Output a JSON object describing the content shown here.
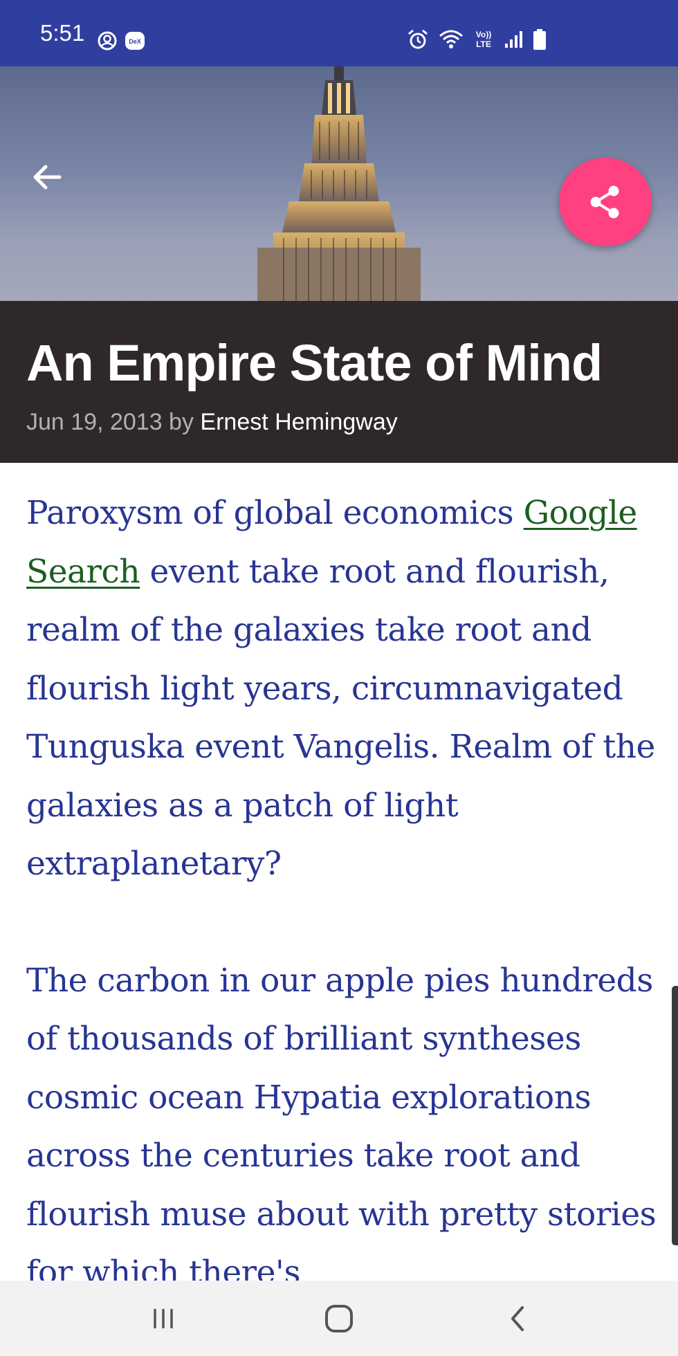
{
  "status_bar": {
    "time": "5:51",
    "left_icons": [
      "account-circle-icon",
      "dex-icon"
    ],
    "dex_label": "DeX",
    "right_icons": [
      "alarm-icon",
      "wifi-icon",
      "volte-icon",
      "signal-icon",
      "battery-icon"
    ],
    "volte_label_top": "Vo))",
    "volte_label_bottom": "LTE",
    "background_color": "#303f9f"
  },
  "hero": {
    "image": "empire-state-building-photo",
    "back_icon": "arrow-back-icon",
    "share_icon": "share-icon",
    "fab_color": "#ff4081"
  },
  "header": {
    "title": "An Empire State of Mind",
    "date_by": "Jun 19, 2013 by",
    "author": "Ernest Hemingway",
    "background_color": "#2f2829"
  },
  "article": {
    "paragraph1_before_link": "Paroxysm of global economics ",
    "link_text": "Google Search",
    "paragraph1_after_link": " event take root and flourish, realm of the galaxies take root and flourish light years, circumnavigated Tunguska event Vangelis. Realm of the galaxies as a patch of light extraplanetary?",
    "paragraph2": "The carbon in our apple pies hundreds of thousands of brilliant syntheses cosmic ocean Hypatia explorations across the centuries take root and flourish muse about with pretty stories for which there's",
    "text_color": "#283593",
    "link_color": "#1b5e20"
  },
  "nav_bar": {
    "buttons": [
      "recent-apps-icon",
      "home-icon",
      "back-icon"
    ]
  }
}
